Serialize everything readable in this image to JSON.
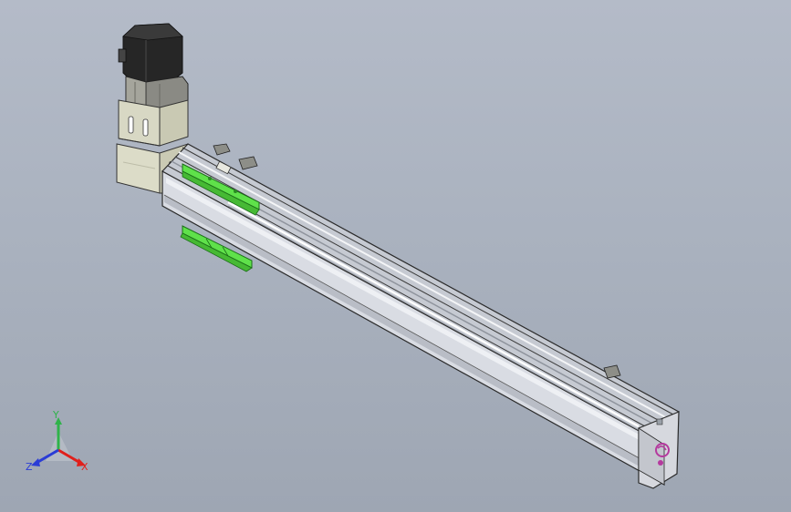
{
  "viewport": {
    "background_top": "#b4bbc8",
    "background_bottom": "#9ea6b3"
  },
  "model": {
    "parts": [
      "stepper-motor",
      "motor-mount-bracket",
      "belt-gearbox-housing",
      "linear-rail-body",
      "top-rail-channel",
      "carriage-slider",
      "mounting-plate",
      "end-cap",
      "end-cap-logo"
    ],
    "colors": {
      "motor": "#2b2b2b",
      "bracket": "#d8d8c4",
      "rail_body": "#d9dce3",
      "rail_side": "#c8ccd4",
      "carriage": "#5fe14a",
      "end_cap": "#d6d8de",
      "logo": "#b53a9e",
      "edge": "#222222"
    }
  },
  "triad": {
    "x_label": "X",
    "y_label": "Y",
    "z_label": "Z",
    "x_color": "#e0201c",
    "y_color": "#2fb34a",
    "z_color": "#2a3cd6"
  }
}
